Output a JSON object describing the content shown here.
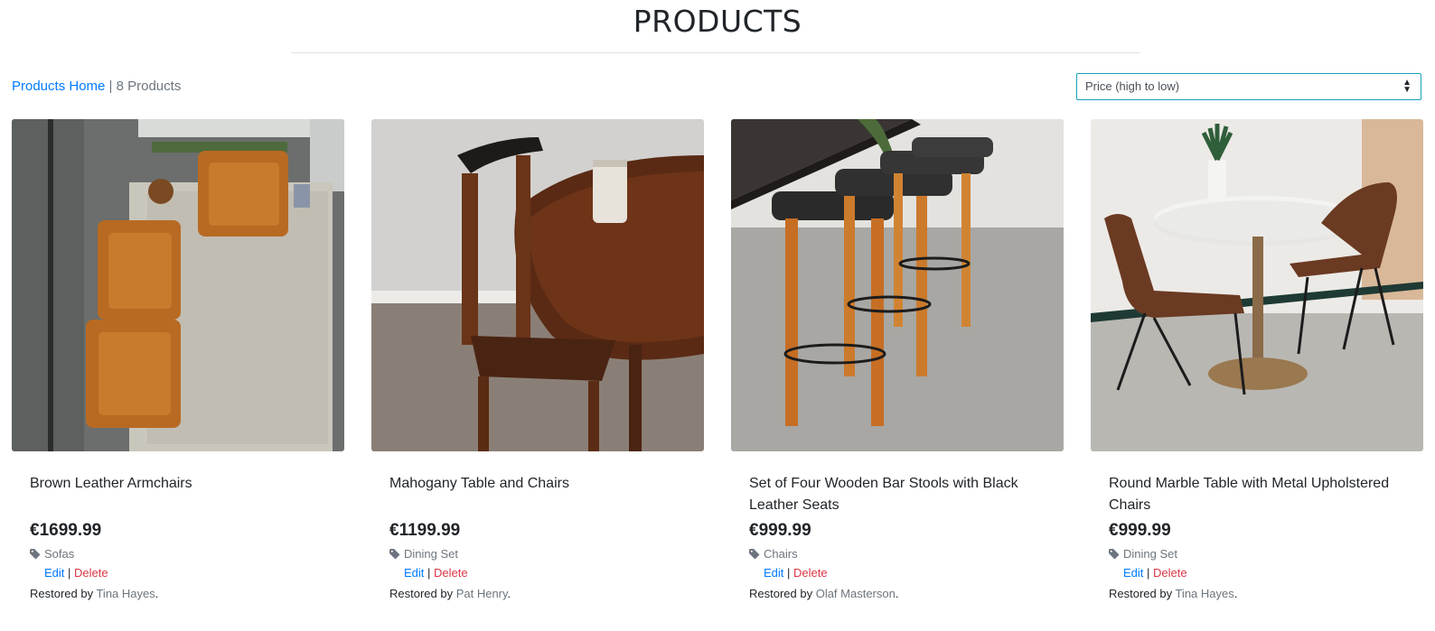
{
  "header": {
    "title": "PRODUCTS"
  },
  "toolbar": {
    "home_link": "Products Home",
    "separator": " | ",
    "count": "8 Products",
    "sort_value": "Price (high to low)"
  },
  "products": [
    {
      "name": "Brown Leather Armchairs",
      "price": "€1699.99",
      "category": "Sofas",
      "edit": "Edit",
      "delete": "Delete",
      "restored_prefix": "Restored by ",
      "restorer": "Tina Hayes",
      "restored_suffix": "."
    },
    {
      "name": "Mahogany Table and Chairs",
      "price": "€1199.99",
      "category": "Dining Set",
      "edit": "Edit",
      "delete": "Delete",
      "restored_prefix": "Restored by ",
      "restorer": "Pat Henry",
      "restored_suffix": "."
    },
    {
      "name": "Set of Four Wooden Bar Stools with Black Leather Seats",
      "price": "€999.99",
      "category": "Chairs",
      "edit": "Edit",
      "delete": "Delete",
      "restored_prefix": "Restored by ",
      "restorer": "Olaf Masterson",
      "restored_suffix": "."
    },
    {
      "name": "Round Marble Table with Metal Upholstered Chairs",
      "price": "€999.99",
      "category": "Dining Set",
      "edit": "Edit",
      "delete": "Delete",
      "restored_prefix": "Restored by ",
      "restorer": "Tina Hayes",
      "restored_suffix": "."
    }
  ],
  "colors": {
    "link": "#007bff",
    "danger": "#dc3545",
    "muted": "#6c757d",
    "select_border": "#17a2b8"
  },
  "icons": {
    "category": "tag-icon",
    "sort_caret": "sort-caret-icon"
  }
}
